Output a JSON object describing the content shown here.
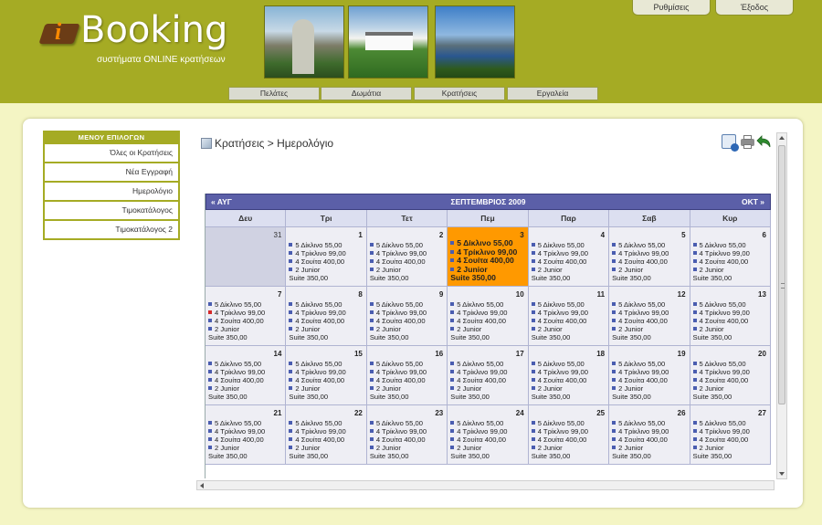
{
  "header": {
    "logo_i": "i",
    "logo_text": "Booking",
    "logo_subtitle": "συστήματα ONLINE κρατήσεων",
    "settings_label": "Ρυθμίσεις",
    "exit_label": "Έξοδος",
    "nav": [
      "Πελάτες",
      "Δωμάτια",
      "Κρατήσεις",
      "Εργαλεία"
    ]
  },
  "sidebar": {
    "title": "ΜΕΝΟΥ ΕΠΙΛΟΓΩΝ",
    "items": [
      "Όλες οι Κρατήσεις",
      "Νέα Εγγραφή",
      "Ημερολόγιο",
      "Τιμοκατάλογος",
      "Τιμοκατάλογος 2"
    ]
  },
  "breadcrumb": "Κρατήσεις > Ημερολόγιο",
  "calendar": {
    "prev_label": "« ΑΥΓ",
    "title": "ΣΕΠΤΕΜΒΡΙΟΣ 2009",
    "next_label": "ΟΚΤ »",
    "days": [
      "Δευ",
      "Τρι",
      "Τετ",
      "Πεμ",
      "Παρ",
      "Σαβ",
      "Κυρ"
    ],
    "lines": [
      "5 Δίκλινο 55,00",
      "4 Τρίκλινο 99,00",
      "4 Σουίτα 400,00",
      "2 Junior",
      "Suite 350,00"
    ],
    "weeks": [
      [
        "31",
        "1",
        "2",
        "3",
        "4",
        "5",
        "6"
      ],
      [
        "7",
        "8",
        "9",
        "10",
        "11",
        "12",
        "13"
      ],
      [
        "14",
        "15",
        "16",
        "17",
        "18",
        "19",
        "20"
      ],
      [
        "21",
        "22",
        "23",
        "24",
        "25",
        "26",
        "27"
      ]
    ],
    "today": "3",
    "flagged_day": "7"
  },
  "colors": {
    "header_bg": "#a5ab24",
    "page_bg": "#f4f5c4",
    "calendar_head": "#5b5fa8",
    "today_bg": "#ff9900",
    "empty_cell": "#d0d2e2"
  }
}
